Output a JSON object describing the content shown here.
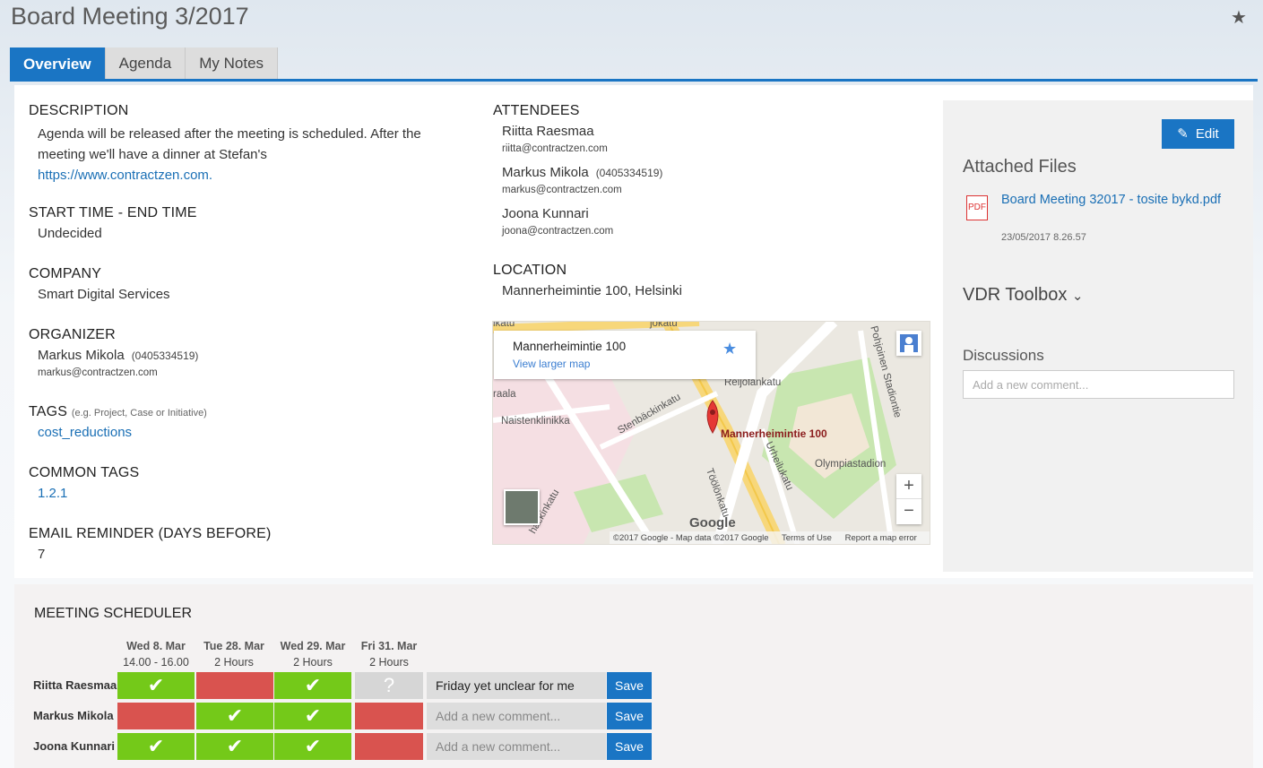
{
  "page": {
    "title": "Board Meeting 3/2017"
  },
  "tabs": [
    "Overview",
    "Agenda",
    "My Notes"
  ],
  "description": {
    "label": "DESCRIPTION",
    "text": "Agenda will be released after the meeting is scheduled. After the meeting we'll have a dinner at Stefan's",
    "link": "https://www.contractzen.com."
  },
  "time": {
    "label_start": "START TIME",
    "label_sep": " - ",
    "label_end": "END TIME",
    "value": "Undecided"
  },
  "company": {
    "label": "COMPANY",
    "value": "Smart Digital Services"
  },
  "organizer": {
    "label": "ORGANIZER",
    "name": "Markus Mikola",
    "phone": "(0405334519)",
    "email": "markus@contractzen.com"
  },
  "tags": {
    "label": "TAGS",
    "hint": "(e.g. Project, Case or Initiative)",
    "value": "cost_reductions"
  },
  "common_tags": {
    "label": "COMMON TAGS",
    "value": "1.2.1"
  },
  "reminder": {
    "label": "EMAIL REMINDER (DAYS BEFORE)",
    "value": "7"
  },
  "attendees": {
    "label": "ATTENDEES",
    "people": [
      {
        "name": "Riitta Raesmaa",
        "phone": "",
        "email": "riitta@contractzen.com"
      },
      {
        "name": "Markus Mikola",
        "phone": "(0405334519)",
        "email": "markus@contractzen.com"
      },
      {
        "name": "Joona Kunnari",
        "phone": "",
        "email": "joona@contractzen.com"
      }
    ]
  },
  "location": {
    "label": "LOCATION",
    "value": "Mannerheimintie 100, Helsinki"
  },
  "map": {
    "card_title": "Mannerheimintie 100",
    "card_link": "View larger map",
    "pin_label": "Mannerheimintie 100",
    "street_labels": [
      "Reijolankatu",
      "Stenbäckinkatu",
      "Urheilukatu",
      "Pohjoinen Stadiontie",
      "Töölönkatu",
      "Naistenklinikka",
      "raala",
      "Olympiastadion",
      "ikatu",
      "häckinkatu",
      "jokatu"
    ],
    "logo": "Google",
    "footer": [
      "©2017 Google - Map data ©2017 Google",
      "Terms of Use",
      "Report a map error"
    ],
    "zoom_in": "+",
    "zoom_out": "−"
  },
  "sidebar": {
    "edit_label": "Edit",
    "files_heading": "Attached Files",
    "file_name": "Board Meeting 32017 - tosite bykd.pdf",
    "file_date": "23/05/2017 8.26.57",
    "toolbox_heading": "VDR Toolbox",
    "discussions_heading": "Discussions",
    "comment_placeholder": "Add a new comment..."
  },
  "scheduler": {
    "title": "MEETING SCHEDULER",
    "dates": [
      {
        "day": "Wed 8. Mar",
        "time": "14.00 - 16.00"
      },
      {
        "day": "Tue 28. Mar",
        "time": "2 Hours"
      },
      {
        "day": "Wed 29. Mar",
        "time": "2 Hours"
      },
      {
        "day": "Fri 31. Mar",
        "time": "2 Hours"
      }
    ],
    "rows": [
      {
        "name": "Riitta Raesmaa",
        "votes": [
          "yes",
          "no",
          "yes",
          "maybe"
        ],
        "comment": "Friday yet unclear for me",
        "placeholder": "Add a new comment..."
      },
      {
        "name": "Markus Mikola",
        "votes": [
          "no",
          "yes",
          "yes",
          "no"
        ],
        "comment": "",
        "placeholder": "Add a new comment..."
      },
      {
        "name": "Joona Kunnari",
        "votes": [
          "yes",
          "yes",
          "yes",
          "no"
        ],
        "comment": "",
        "placeholder": "Add a new comment..."
      }
    ],
    "save_label": "Save",
    "vote_colors": {
      "yes": "#74c919",
      "no": "#d9534f",
      "maybe": "#d6d6d6"
    }
  }
}
